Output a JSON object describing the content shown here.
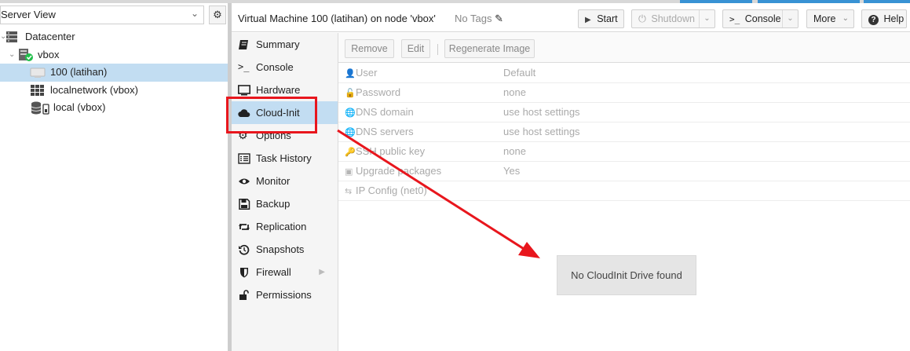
{
  "left_panel": {
    "view_selector": "Server View",
    "tree": [
      {
        "label": "Datacenter",
        "icon": "datacenter-icon"
      },
      {
        "label": "vbox",
        "icon": "node-online-icon"
      },
      {
        "label": "100 (latihan)",
        "icon": "vm-icon",
        "selected": true
      },
      {
        "label": "localnetwork (vbox)",
        "icon": "network-grid-icon"
      },
      {
        "label": "local (vbox)",
        "icon": "storage-icon"
      }
    ]
  },
  "header": {
    "title": "Virtual Machine 100 (latihan) on node 'vbox'",
    "tags": "No Tags",
    "buttons": {
      "start": "Start",
      "shutdown": "Shutdown",
      "console": "Console",
      "more": "More",
      "help": "Help"
    }
  },
  "nav": {
    "items": [
      {
        "label": "Summary",
        "icon": "book-icon"
      },
      {
        "label": "Console",
        "icon": "terminal-icon"
      },
      {
        "label": "Hardware",
        "icon": "desktop-icon"
      },
      {
        "label": "Cloud-Init",
        "icon": "cloud-icon",
        "selected": true
      },
      {
        "label": "Options",
        "icon": "gear-icon"
      },
      {
        "label": "Task History",
        "icon": "list-icon"
      },
      {
        "label": "Monitor",
        "icon": "eye-icon"
      },
      {
        "label": "Backup",
        "icon": "floppy-icon"
      },
      {
        "label": "Replication",
        "icon": "retweet-icon"
      },
      {
        "label": "Snapshots",
        "icon": "history-icon"
      },
      {
        "label": "Firewall",
        "icon": "shield-icon"
      },
      {
        "label": "Permissions",
        "icon": "unlock-icon"
      }
    ]
  },
  "toolbar": {
    "remove": "Remove",
    "edit": "Edit",
    "regenerate": "Regenerate Image"
  },
  "cloudinit": {
    "rows": [
      {
        "key": "User",
        "value": "Default",
        "icon": "user-icon"
      },
      {
        "key": "Password",
        "value": "none",
        "icon": "unlock-icon"
      },
      {
        "key": "DNS domain",
        "value": "use host settings",
        "icon": "globe-icon"
      },
      {
        "key": "DNS servers",
        "value": "use host settings",
        "icon": "globe-icon"
      },
      {
        "key": "SSH public key",
        "value": "none",
        "icon": "key-icon"
      },
      {
        "key": "Upgrade packages",
        "value": "Yes",
        "icon": "archive-icon"
      },
      {
        "key": "IP Config (net0)",
        "value": "",
        "icon": "exchange-icon"
      }
    ],
    "empty_message": "No CloudInit Drive found"
  },
  "colors": {
    "selection": "#c2ddf2",
    "annotation": "#e8161d",
    "online": "#21bf4b"
  }
}
